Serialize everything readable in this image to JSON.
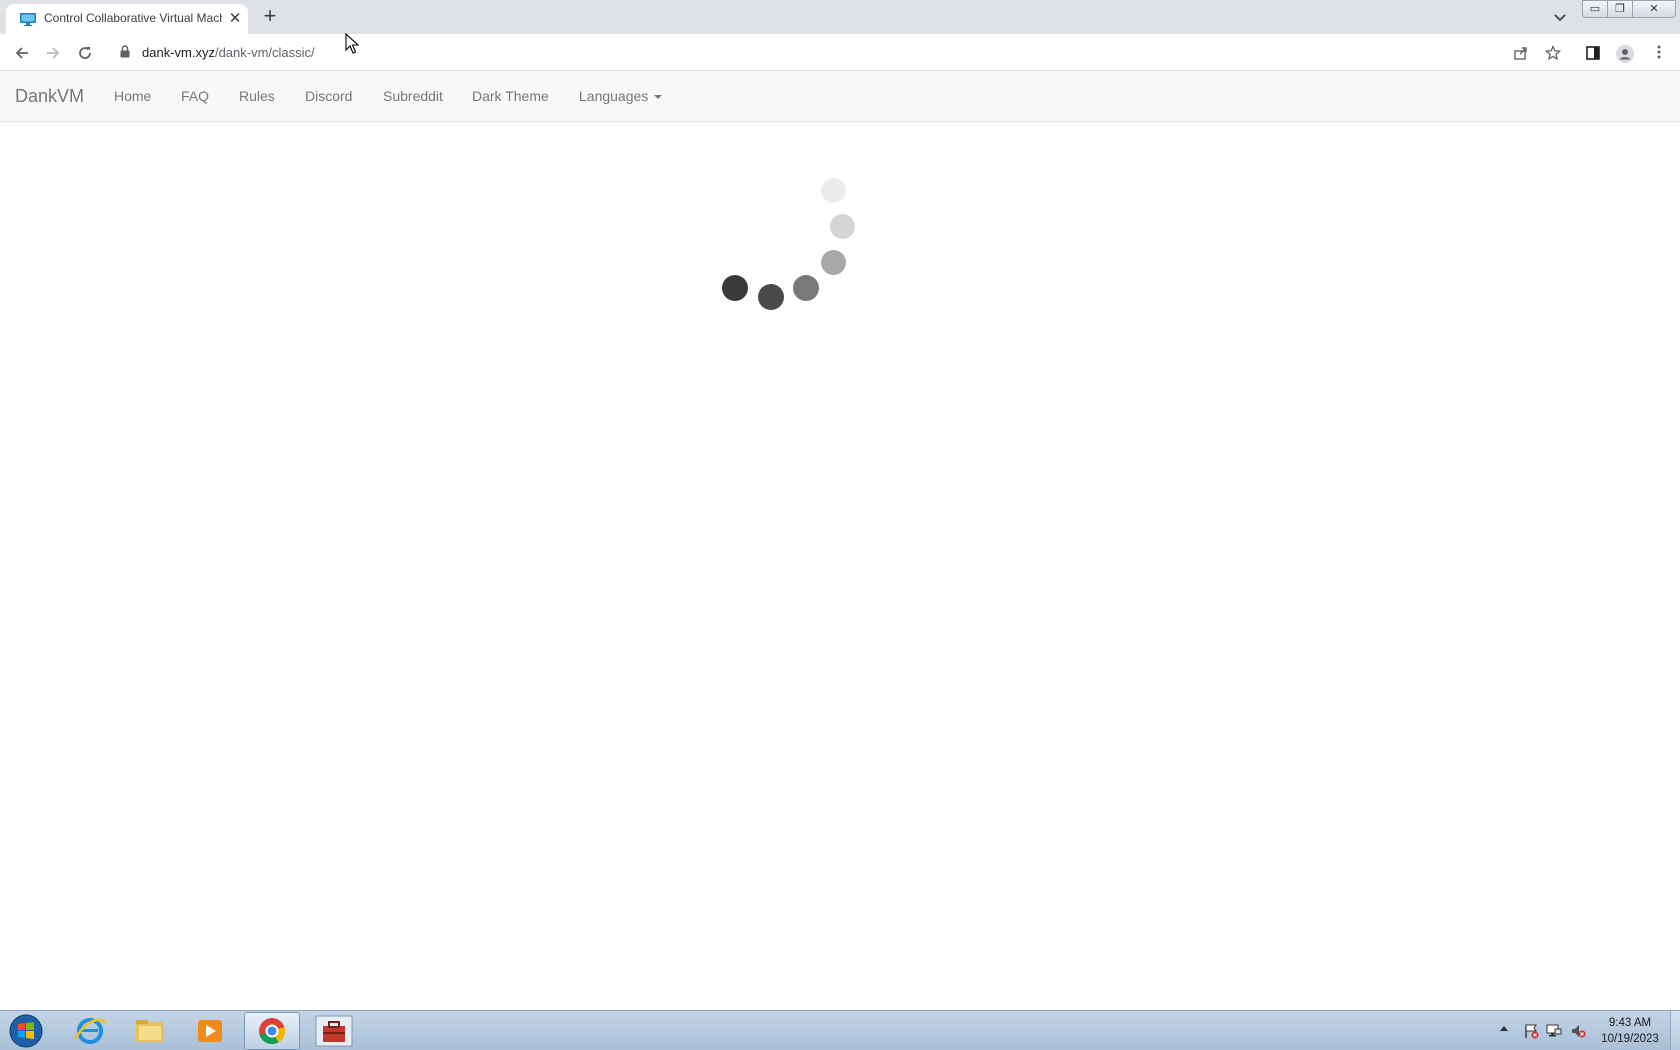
{
  "browser": {
    "tab_title": "Control Collaborative Virtual Machines",
    "new_tab_label": "+",
    "close_tab_label": "✕",
    "url_host": "dank-vm.xyz",
    "url_path": "/dank-vm/classic/",
    "window_min": "▭",
    "window_max": "❐",
    "window_close": "✕"
  },
  "navbar": {
    "brand": "DankVM",
    "links": [
      "Home",
      "FAQ",
      "Rules",
      "Discord",
      "Subreddit",
      "Dark Theme"
    ],
    "languages_label": "Languages"
  },
  "loading": {
    "state": "loading",
    "dot_colors": [
      "#3a3a3a",
      "#4a4a4a",
      "#7a7a7a",
      "#a8a8a8",
      "#d4d4d4",
      "#ececec"
    ]
  },
  "taskbar": {
    "apps": [
      "start-orb",
      "internet-explorer",
      "file-explorer",
      "media-player",
      "google-chrome",
      "toolbox-app"
    ],
    "active_app": "google-chrome",
    "clock_time": "9:43 AM",
    "clock_date": "10/19/2023"
  }
}
